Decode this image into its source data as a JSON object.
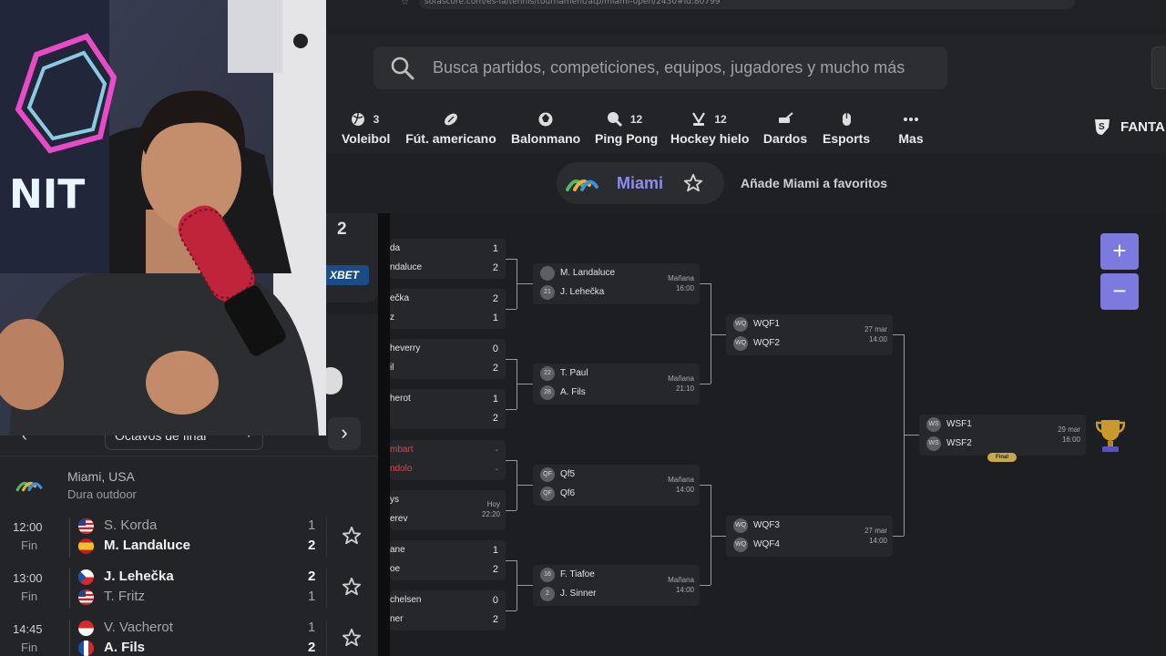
{
  "browser": {
    "url": "sofascore.com/es-la/tennis/tournament/atp/miami-open/2430#id:80799"
  },
  "search": {
    "placeholder": "Busca partidos, competiciones, equipos, jugadores y mucho más"
  },
  "sports": [
    {
      "label": "Voleibol",
      "count": "3",
      "icon": "volleyball-icon"
    },
    {
      "label": "Fút. americano",
      "count": "",
      "icon": "american-football-icon"
    },
    {
      "label": "Balonmano",
      "count": "",
      "icon": "handball-icon"
    },
    {
      "label": "Ping Pong",
      "count": "12",
      "icon": "table-tennis-icon"
    },
    {
      "label": "Hockey hielo",
      "count": "12",
      "icon": "ice-hockey-icon"
    },
    {
      "label": "Dardos",
      "count": "",
      "icon": "darts-icon"
    },
    {
      "label": "Esports",
      "count": "",
      "icon": "esports-icon"
    },
    {
      "label": "Mas",
      "count": "",
      "icon": "more-icon"
    }
  ],
  "fantasy": {
    "label": "FANTA"
  },
  "tournament": {
    "name": "Miami",
    "fav_text": "Añade Miami a favoritos"
  },
  "left": {
    "top_number": "2",
    "sponsor": "XBET",
    "round": "Octavos de final",
    "event_name": "Miami, USA",
    "event_surface": "Dura outdoor",
    "matches": [
      {
        "time": "12:00",
        "status": "Fin",
        "p1": "S. Korda",
        "p2": "M. Landaluce",
        "s1": "1",
        "s2": "2",
        "winner": 2,
        "f1": "us",
        "f2": "es"
      },
      {
        "time": "13:00",
        "status": "Fin",
        "p1": "J. Lehečka",
        "p2": "T. Fritz",
        "s1": "2",
        "s2": "1",
        "winner": 1,
        "f1": "cz",
        "f2": "us"
      },
      {
        "time": "14:45",
        "status": "Fin",
        "p1": "V. Vacherot",
        "p2": "A. Fils",
        "s1": "1",
        "s2": "2",
        "winner": 2,
        "f1": "mc",
        "f2": "fr"
      }
    ]
  },
  "bracket": {
    "r16": [
      {
        "p1": "da",
        "p2": "ndaluce",
        "s1": "1",
        "s2": "2"
      },
      {
        "p1": "ečka",
        "p2": "z",
        "s1": "2",
        "s2": "1"
      },
      {
        "p1": "heverry",
        "p2": "il",
        "s1": "0",
        "s2": "2"
      },
      {
        "p1": "herot",
        "p2": "",
        "s1": "1",
        "s2": "2"
      },
      {
        "p1": "mbart",
        "p2": "ndolo",
        "s1": "-",
        "s2": "-",
        "live": true
      },
      {
        "p1": "ys",
        "p2": "erev",
        "s1": "",
        "s2": "",
        "day": "Hoy",
        "time": "22:20"
      },
      {
        "p1": "ane",
        "p2": "oe",
        "s1": "1",
        "s2": "2"
      },
      {
        "p1": "chelsen",
        "p2": "ner",
        "s1": "0",
        "s2": "2"
      }
    ],
    "qf": [
      {
        "p1": "M. Landaluce",
        "p2": "J. Lehečka",
        "a1": "",
        "a2": "21",
        "day": "Mañana",
        "time": "16:00"
      },
      {
        "p1": "T. Paul",
        "p2": "A. Fils",
        "a1": "22",
        "a2": "28",
        "day": "Mañana",
        "time": "21:10"
      },
      {
        "p1": "Qf5",
        "p2": "Qf6",
        "a1": "QF",
        "a2": "QF",
        "day": "Mañana",
        "time": "14:00"
      },
      {
        "p1": "F. Tiafoe",
        "p2": "J. Sinner",
        "a1": "16",
        "a2": "2",
        "day": "Mañana",
        "time": "14:00"
      }
    ],
    "sf": [
      {
        "p1": "WQF1",
        "p2": "WQF2",
        "a1": "WQ",
        "a2": "WQ",
        "day": "27 mar",
        "time": "14:00"
      },
      {
        "p1": "WQF3",
        "p2": "WQF4",
        "a1": "WQ",
        "a2": "WQ",
        "day": "27 mar",
        "time": "14:00"
      }
    ],
    "final": {
      "p1": "WSF1",
      "p2": "WSF2",
      "a1": "WS",
      "a2": "WS",
      "day": "29 mar",
      "time": "16:00",
      "badge": "Final"
    }
  },
  "zoom": {
    "in": "+",
    "out": "−"
  },
  "colors": {
    "accent": "#7c7adf",
    "brand_text": "#8d8cf0",
    "live_red": "#e0464b"
  }
}
